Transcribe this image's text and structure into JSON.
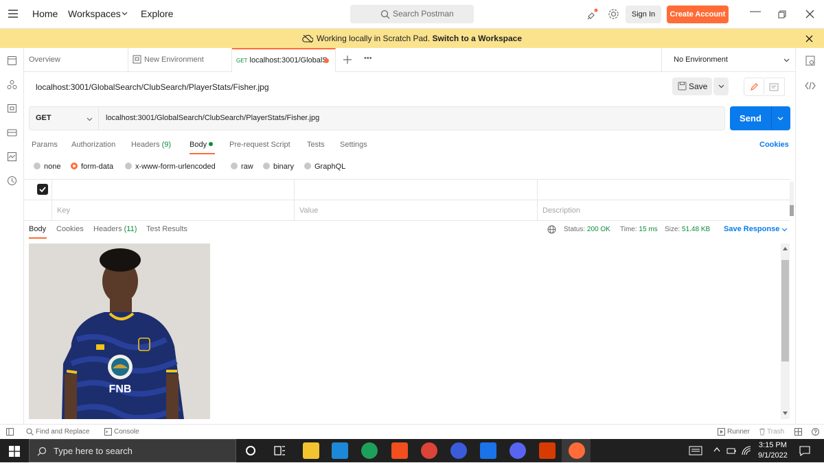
{
  "topbar": {
    "nav": [
      "Home",
      "Workspaces",
      "Explore"
    ],
    "search_placeholder": "Search Postman",
    "signin": "Sign In",
    "create_account": "Create Account"
  },
  "banner": {
    "text": "Working locally in Scratch Pad.",
    "link": "Switch to a Workspace"
  },
  "tabs": [
    {
      "label": "Overview"
    },
    {
      "label": "New Environment"
    },
    {
      "method": "GET",
      "label": "localhost:3001/GlobalS"
    }
  ],
  "environment": "No Environment",
  "request": {
    "title": "localhost:3001/GlobalSearch/ClubSearch/PlayerStats/Fisher.jpg",
    "save": "Save",
    "method": "GET",
    "url": "localhost:3001/GlobalSearch/ClubSearch/PlayerStats/Fisher.jpg",
    "send": "Send"
  },
  "request_tabs": {
    "params": "Params",
    "authorization": "Authorization",
    "headers": "Headers",
    "headers_count": "(9)",
    "body": "Body",
    "prerequest": "Pre-request Script",
    "tests": "Tests",
    "settings": "Settings",
    "cookies": "Cookies"
  },
  "body_types": [
    "none",
    "form-data",
    "x-www-form-urlencoded",
    "raw",
    "binary",
    "GraphQL"
  ],
  "form_table": {
    "key": "Key",
    "value": "Value",
    "description": "Description"
  },
  "response": {
    "body": "Body",
    "cookies": "Cookies",
    "headers": "Headers",
    "headers_count": "(11)",
    "test_results": "Test Results",
    "status_label": "Status:",
    "status": "200 OK",
    "time_label": "Time:",
    "time": "15 ms",
    "size_label": "Size:",
    "size": "51.48 KB",
    "save_response": "Save Response",
    "jersey_text": "FNB"
  },
  "statusbar": {
    "find_replace": "Find and Replace",
    "console": "Console",
    "runner": "Runner",
    "trash": "Trash"
  },
  "taskbar": {
    "search_placeholder": "Type here to search",
    "time": "3:15 PM",
    "date": "9/1/2022"
  },
  "colors": {
    "accent": "#ff6c37",
    "primary": "#097bed",
    "banner": "#fbe38e",
    "success": "#0a8c3a"
  }
}
